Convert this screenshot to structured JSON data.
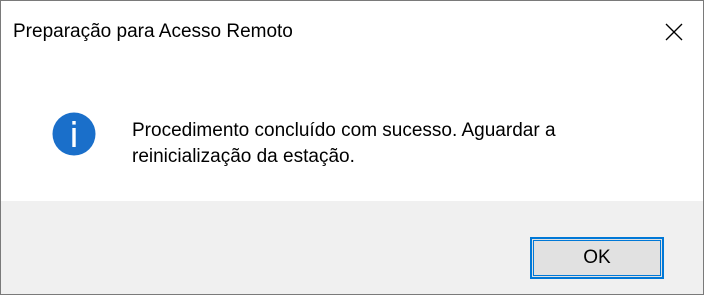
{
  "window": {
    "title": "Preparação para Acesso Remoto"
  },
  "dialog": {
    "icon": "info-icon",
    "message": "Procedimento concluído com sucesso. Aguardar a reinicialização da estação.",
    "ok_label": "OK"
  },
  "colors": {
    "accent": "#0078d7",
    "footer_bg": "#f0f0f0",
    "button_bg": "#e1e1e1"
  }
}
